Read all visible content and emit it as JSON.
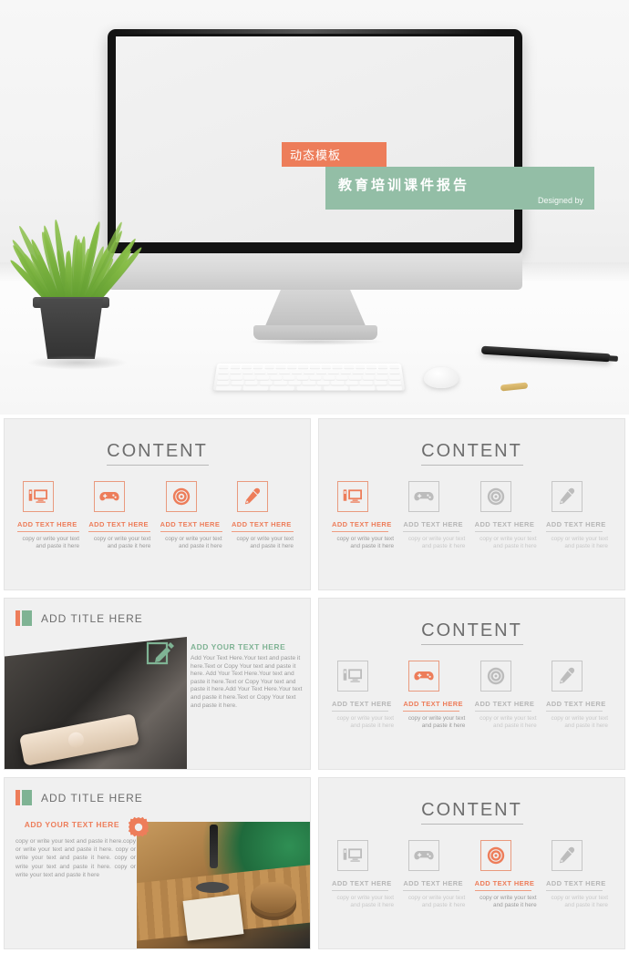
{
  "hero": {
    "badge_label": "动态模板",
    "banner_title": "教育培训课件报告",
    "banner_subtitle": "Designed by",
    "apple_logo_glyph": "",
    "colors": {
      "orange": "#ED7D5A",
      "green": "#93BEA6"
    }
  },
  "slides": [
    {
      "id": "slide-content-1",
      "title": "CONTENT",
      "active_index": -1,
      "all_active": true,
      "items": [
        {
          "icon": "monitor-icon",
          "head": "ADD TEXT HERE",
          "body": "copy or write your text and paste it here"
        },
        {
          "icon": "gamepad-icon",
          "head": "ADD TEXT HERE",
          "body": "copy or write your text and paste it here"
        },
        {
          "icon": "disc-icon",
          "head": "ADD TEXT HERE",
          "body": "copy or write your text and paste it here"
        },
        {
          "icon": "eyedropper-icon",
          "head": "ADD TEXT HERE",
          "body": "copy or write your text and paste it here"
        }
      ]
    },
    {
      "id": "slide-content-2",
      "title": "CONTENT",
      "active_index": 0,
      "items": [
        {
          "icon": "monitor-icon",
          "head": "ADD TEXT HERE",
          "body": "copy or write your text and paste it here"
        },
        {
          "icon": "gamepad-icon",
          "head": "ADD TEXT HERE",
          "body": "copy or write your text and paste it here"
        },
        {
          "icon": "disc-icon",
          "head": "ADD TEXT HERE",
          "body": "copy or write your text and paste it here"
        },
        {
          "icon": "eyedropper-icon",
          "head": "ADD TEXT HERE",
          "body": "copy or write your text and paste it here"
        }
      ]
    },
    {
      "id": "slide-content-3",
      "title": "CONTENT",
      "active_index": 1,
      "items": [
        {
          "icon": "monitor-icon",
          "head": "ADD TEXT HERE",
          "body": "copy or write your text and paste it here"
        },
        {
          "icon": "gamepad-icon",
          "head": "ADD TEXT HERE",
          "body": "copy or write your text and paste it here"
        },
        {
          "icon": "disc-icon",
          "head": "ADD TEXT HERE",
          "body": "copy or write your text and paste it here"
        },
        {
          "icon": "eyedropper-icon",
          "head": "ADD TEXT HERE",
          "body": "copy or write your text and paste it here"
        }
      ]
    },
    {
      "id": "slide-content-4",
      "title": "CONTENT",
      "active_index": 2,
      "items": [
        {
          "icon": "monitor-icon",
          "head": "ADD TEXT HERE",
          "body": "copy or write your text and paste it here"
        },
        {
          "icon": "gamepad-icon",
          "head": "ADD TEXT HERE",
          "body": "copy or write your text and paste it here"
        },
        {
          "icon": "disc-icon",
          "head": "ADD TEXT HERE",
          "body": "copy or write your text and paste it here"
        },
        {
          "icon": "eyedropper-icon",
          "head": "ADD TEXT HERE",
          "body": "copy or write your text and paste it here"
        }
      ]
    }
  ],
  "slide_phone": {
    "title": "ADD TITLE HERE",
    "section_head": "ADD YOUR TEXT HERE",
    "section_body": "Add Your Text Here.Your text and paste it here.Text or Copy Your text and paste it here. Add Your Text Here.Your text and paste it here.Text or Copy Your text and paste it here.Add Your Text Here.Your text and paste it here.Text or Copy Your text and paste it here.",
    "icon": "edit-square-icon"
  },
  "slide_wood": {
    "title": "ADD TITLE HERE",
    "section_head": "ADD YOUR TEXT HERE",
    "section_body": "copy or write your text and paste it here.copy or write your text and paste it here. copy or write your text and paste it here. copy or write your text and paste it here. copy or write your text and paste it here",
    "icon": "gear-icon"
  }
}
